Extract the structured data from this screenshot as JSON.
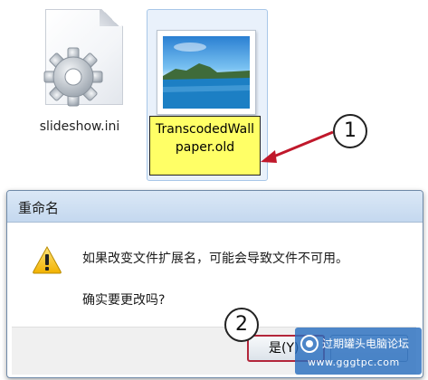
{
  "files": [
    {
      "name": "slideshow.ini",
      "icon": "settings-file-icon"
    },
    {
      "name": "TranscodedWallpaper.old",
      "name_line1": "TranscodedWall",
      "name_line2": "paper.old",
      "icon": "image-thumbnail-icon"
    }
  ],
  "callouts": [
    "1",
    "2"
  ],
  "dialog": {
    "title": "重命名",
    "message": "如果改变文件扩展名，可能会导致文件不可用。",
    "confirm": "确实要更改吗?",
    "yes_label": "是(Y)",
    "no_label": ""
  },
  "watermark": {
    "name": "过期罐头电脑论坛",
    "url": "www.gggtpc.com"
  },
  "colors": {
    "rename_highlight": "#ffff66",
    "callout_arrow": "#c0182b",
    "selection_bg": "#e9f1fb"
  }
}
